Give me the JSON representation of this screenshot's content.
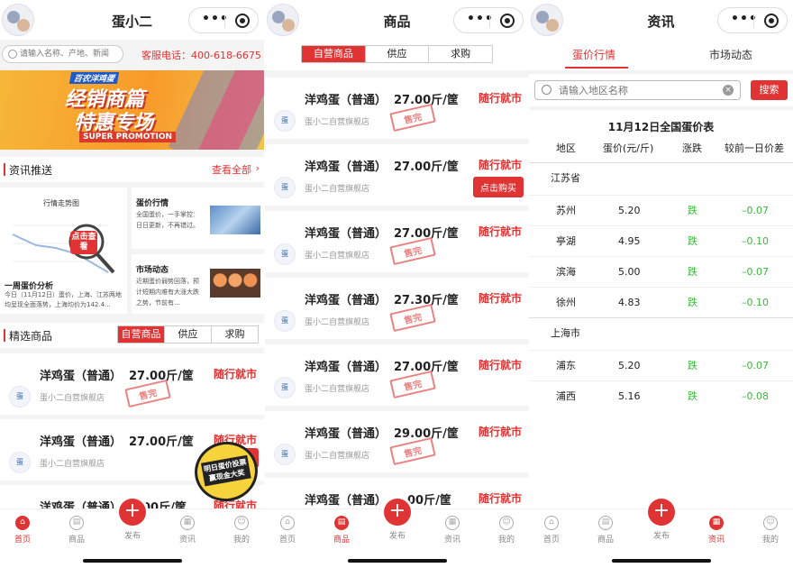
{
  "accent": "#e03333",
  "capsule": {
    "more_icon": "ellipsis-icon",
    "close_icon": "target-circle-icon"
  },
  "tabbar": {
    "items": [
      "首页",
      "商品",
      "发布",
      "资讯",
      "我的"
    ]
  },
  "home": {
    "title": "蛋小二",
    "search_placeholder": "请输入名称、产地、新闻",
    "hotline": "客服电话：400-618-6675",
    "banner": {
      "tag": "百农洋鸡蛋",
      "line1": "经销商篇",
      "line2": "特惠专场",
      "line3": "SUPER PROMOTION"
    },
    "news_section": {
      "title": "资讯推送",
      "link": "查看全部"
    },
    "trend_card": {
      "chart_title": "行情走势图",
      "badge": "点击查看",
      "title": "一周蛋价分析",
      "desc": "今日（11月12日）蛋价，上海、江苏两地均呈现全面落势，上海均价为142.4..."
    },
    "price_card": {
      "title": "蛋价行情",
      "desc": "全国蛋价，一手掌控：日日更新，不再错过。"
    },
    "market_card": {
      "title": "市场动态",
      "desc": "近期蛋价弱势回落，预计短期内难有大涨大跌之势，节前有..."
    },
    "picks": {
      "title": "精选商品",
      "tabs": [
        "自营商品",
        "供应",
        "求购"
      ]
    },
    "products": [
      {
        "name": "洋鸡蛋（普通）",
        "price": "27.00斤/筐",
        "status": "随行就市",
        "shop": "蛋小二自营旗舰店",
        "soldout": "售完"
      },
      {
        "name": "洋鸡蛋（普通）",
        "price": "27.00斤/筐",
        "status": "随行就市",
        "shop": "蛋小二自营旗舰店"
      },
      {
        "name": "洋鸡蛋（普通）",
        "price": "00斤/筐",
        "status": "随行就市"
      }
    ],
    "promo_badge": "明日蛋价投票 赢现金大奖"
  },
  "goods": {
    "title": "商品",
    "tabs": [
      "自营商品",
      "供应",
      "求购"
    ],
    "products": [
      {
        "name": "洋鸡蛋（普通）",
        "price": "27.00斤/筐",
        "status": "随行就市",
        "shop": "蛋小二自营旗舰店",
        "soldout": "售完"
      },
      {
        "name": "洋鸡蛋（普通）",
        "price": "27.00斤/筐",
        "status": "随行就市",
        "shop": "蛋小二自营旗舰店",
        "buy": "点击购买"
      },
      {
        "name": "洋鸡蛋（普通）",
        "price": "27.00斤/筐",
        "status": "随行就市",
        "shop": "蛋小二自营旗舰店",
        "soldout": "售完"
      },
      {
        "name": "洋鸡蛋（普通）",
        "price": "27.30斤/筐",
        "status": "随行就市",
        "shop": "蛋小二自营旗舰店",
        "soldout": "售完"
      },
      {
        "name": "洋鸡蛋（普通）",
        "price": "27.00斤/筐",
        "status": "随行就市",
        "shop": "蛋小二自营旗舰店",
        "soldout": "售完"
      },
      {
        "name": "洋鸡蛋（普通）",
        "price": "29.00斤/筐",
        "status": "随行就市",
        "shop": "蛋小二自营旗舰店",
        "soldout": "售完"
      },
      {
        "name": "洋鸡蛋（普通）",
        "price": "00斤/筐",
        "status": "随行就市"
      }
    ]
  },
  "news": {
    "title": "资讯",
    "tabs": [
      "蛋价行情",
      "市场动态"
    ],
    "search_placeholder": "请输入地区名称",
    "search_button": "搜索",
    "table_title": "11月12日全国蛋价表",
    "headers": [
      "地区",
      "蛋价(元/斤)",
      "涨跌",
      "较前一日价差"
    ],
    "down_color": "#3cb83c",
    "groups": [
      {
        "province": "江苏省",
        "rows": [
          [
            "苏州",
            "5.20",
            "跌",
            "–0.07"
          ],
          [
            "亭湖",
            "4.95",
            "跌",
            "–0.10"
          ],
          [
            "滨海",
            "5.00",
            "跌",
            "–0.07"
          ],
          [
            "徐州",
            "4.83",
            "跌",
            "–0.10"
          ]
        ]
      },
      {
        "province": "上海市",
        "rows": [
          [
            "浦东",
            "5.20",
            "跌",
            "–0.07"
          ],
          [
            "浦西",
            "5.16",
            "跌",
            "–0.08"
          ]
        ]
      }
    ]
  }
}
